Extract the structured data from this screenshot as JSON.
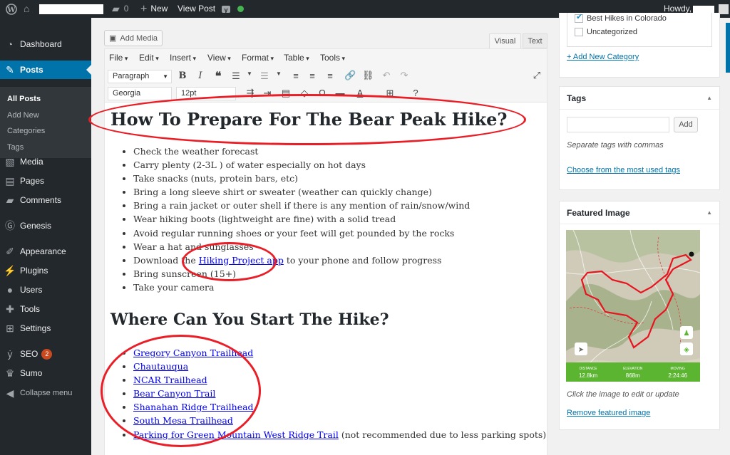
{
  "adminbar": {
    "comments_count": "0",
    "new_label": "New",
    "view_post": "View Post",
    "howdy": "Howdy,",
    "colors": {
      "status_dot": "#46b450"
    }
  },
  "sidebar": {
    "items": [
      {
        "name": "dashboard",
        "label": "Dashboard",
        "icon": "dashboard-icon"
      },
      {
        "name": "posts",
        "label": "Posts",
        "icon": "pin-icon"
      },
      {
        "name": "media",
        "label": "Media",
        "icon": "media-icon"
      },
      {
        "name": "pages",
        "label": "Pages",
        "icon": "page-icon"
      },
      {
        "name": "comments",
        "label": "Comments",
        "icon": "comment-icon"
      },
      {
        "name": "genesis",
        "label": "Genesis",
        "icon": "genesis-icon"
      },
      {
        "name": "appearance",
        "label": "Appearance",
        "icon": "brush-icon"
      },
      {
        "name": "plugins",
        "label": "Plugins",
        "icon": "plug-icon"
      },
      {
        "name": "users",
        "label": "Users",
        "icon": "user-icon"
      },
      {
        "name": "tools",
        "label": "Tools",
        "icon": "wrench-icon"
      },
      {
        "name": "settings",
        "label": "Settings",
        "icon": "settings-icon"
      },
      {
        "name": "seo",
        "label": "SEO",
        "icon": "yoast-icon",
        "badge": "2"
      },
      {
        "name": "sumo",
        "label": "Sumo",
        "icon": "crown-icon"
      },
      {
        "name": "collapse",
        "label": "Collapse menu",
        "icon": "collapse-icon"
      }
    ],
    "submenu": [
      "All Posts",
      "Add New",
      "Categories",
      "Tags"
    ]
  },
  "editor": {
    "add_media": "Add Media",
    "tab_visual": "Visual",
    "tab_text": "Text",
    "menubar": [
      "File",
      "Edit",
      "Insert",
      "View",
      "Format",
      "Table",
      "Tools"
    ],
    "format_select": "Paragraph",
    "font_select": "Georgia",
    "size_select": "12pt"
  },
  "content": {
    "heading1": "How To Prepare For The Bear Peak Hike?",
    "list1": [
      "Check the weather forecast",
      "Carry plenty (2-3L ) of water especially on hot days",
      "Take snacks (nuts, protein bars, etc)",
      "Bring a long sleeve shirt or sweater (weather can quickly change)",
      "Bring a rain jacket or outer shell if there is any mention of rain/snow/wind",
      "Wear hiking boots (lightweight are fine) with a solid tread",
      "Avoid regular running shoes or your feet will get pounded by the rocks",
      "Wear a hat and sunglasses"
    ],
    "download_pre": "Download the ",
    "download_link": "Hiking Project app",
    "download_post": " to your phone and follow progress",
    "list1b": [
      "Bring sunscreen (15+)",
      "Take your camera"
    ],
    "heading2": "Where Can You Start The Hike?",
    "trailheads": [
      "Gregory Canyon Trailhead",
      "Chautauqua",
      "NCAR Trailhead",
      "Bear Canyon Trail",
      "Shanahan Ridge Trailhead",
      "South Mesa Trailhead"
    ],
    "last_link": "Parking for Green Mountain West Ridge Trail",
    "last_note": " (not recommended due to less parking spots)"
  },
  "categories": {
    "items": [
      {
        "label": "Best Hikes in Colorado",
        "checked": true
      },
      {
        "label": "Uncategorized",
        "checked": false
      }
    ],
    "add_new": "+ Add New Category"
  },
  "tags": {
    "title": "Tags",
    "add": "Add",
    "hint": "Separate tags with commas",
    "choose": "Choose from the most used tags"
  },
  "featured": {
    "title": "Featured Image",
    "stats": [
      {
        "label": "DISTANCE",
        "value": "12.8km"
      },
      {
        "label": "ELEVATION",
        "value": "868m"
      },
      {
        "label": "MOVING",
        "value": "2:24:46"
      }
    ],
    "hint": "Click the image to edit or update",
    "remove": "Remove featured image"
  },
  "colors": {
    "accent": "#0073aa",
    "annotation": "#ea1e26",
    "map_bar": "#5cb531"
  }
}
